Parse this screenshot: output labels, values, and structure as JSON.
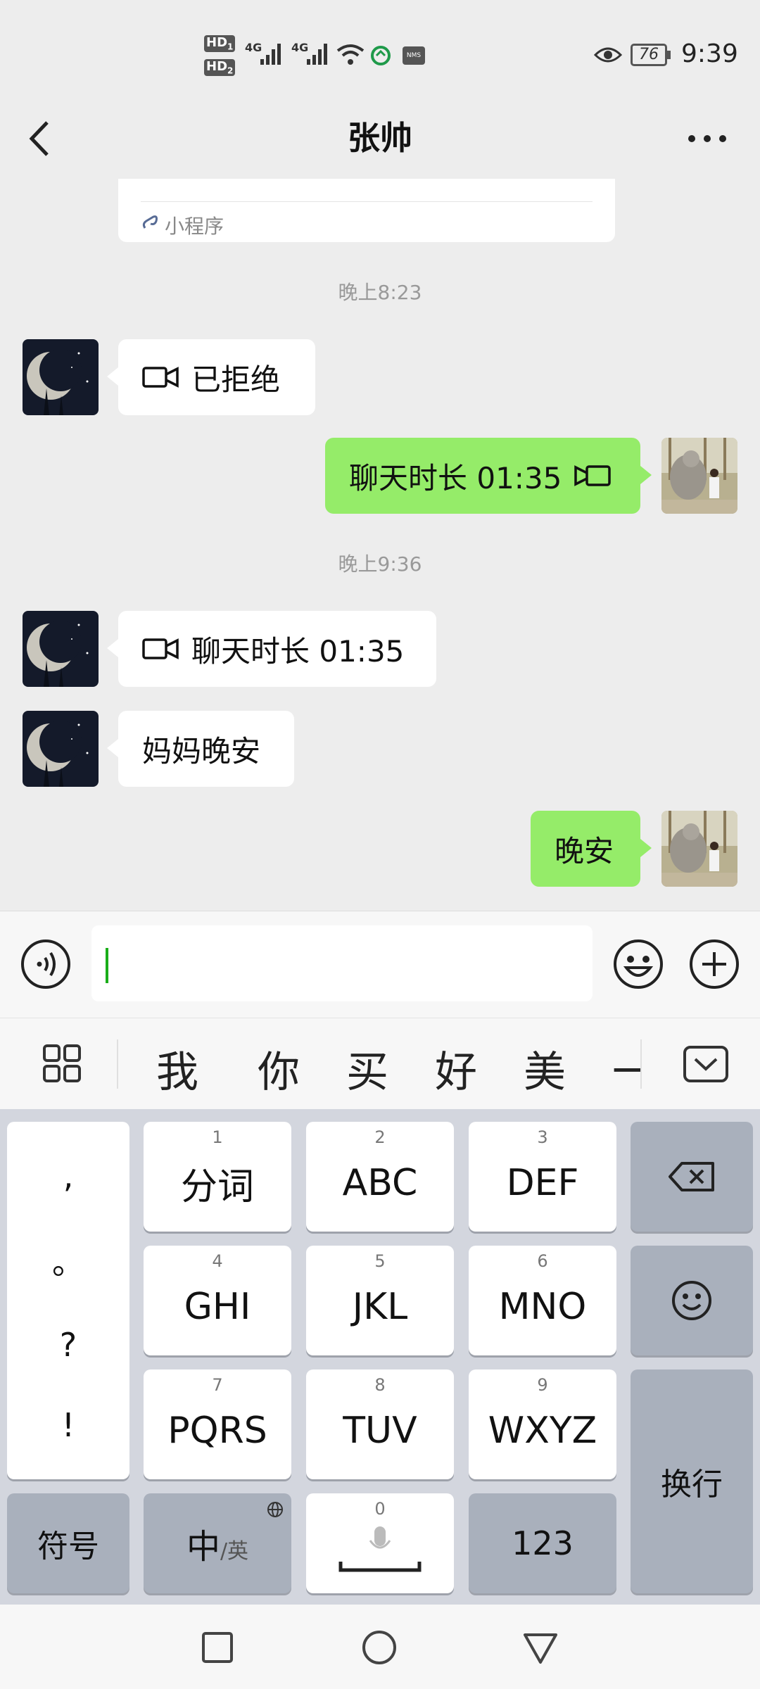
{
  "status_bar": {
    "hd1": "HD",
    "hd1_sub": "1",
    "hd2": "HD",
    "hd2_sub": "2",
    "net1": "4G",
    "net2": "4G",
    "nfc_badge": "NMS",
    "battery": "76",
    "time": "9:39"
  },
  "header": {
    "title": "张帅",
    "back_icon": "chevron-left-icon",
    "more_icon": "more-dots-icon"
  },
  "chat": {
    "miniprogram_label": "小程序",
    "messages": [
      {
        "type": "time",
        "text": "晚上8:23"
      },
      {
        "type": "in",
        "icon": "video-call-icon",
        "text": "已拒绝"
      },
      {
        "type": "out",
        "icon": "video-call-icon",
        "text": "聊天时长 01:35"
      },
      {
        "type": "time",
        "text": "晚上9:36"
      },
      {
        "type": "in",
        "icon": "video-call-icon",
        "text": "聊天时长 01:35"
      },
      {
        "type": "in",
        "text": "妈妈晚安"
      },
      {
        "type": "out",
        "text": "晚安"
      }
    ]
  },
  "input_bar": {
    "voice_icon": "voice-icon",
    "value": "",
    "emoji_icon": "emoji-icon",
    "plus_icon": "plus-icon"
  },
  "candidates": {
    "menu_icon": "grid-icon",
    "items": [
      "我",
      "你",
      "买",
      "好",
      "美",
      "一"
    ],
    "collapse_icon": "keyboard-collapse-icon"
  },
  "keyboard": {
    "punct": [
      ",",
      "。",
      "?",
      "!"
    ],
    "keys": [
      {
        "num": "1",
        "label": "分词"
      },
      {
        "num": "2",
        "label": "ABC"
      },
      {
        "num": "3",
        "label": "DEF"
      },
      {
        "num": "4",
        "label": "GHI"
      },
      {
        "num": "5",
        "label": "JKL"
      },
      {
        "num": "6",
        "label": "MNO"
      },
      {
        "num": "7",
        "label": "PQRS"
      },
      {
        "num": "8",
        "label": "TUV"
      },
      {
        "num": "9",
        "label": "WXYZ"
      }
    ],
    "symbols": "符号",
    "lang_main": "中",
    "lang_alt": "/英",
    "space_num": "0",
    "num_key": "123",
    "enter": "换行"
  },
  "colors": {
    "accent_green": "#95ec69",
    "caret_green": "#1aad19",
    "background": "#ededed"
  }
}
